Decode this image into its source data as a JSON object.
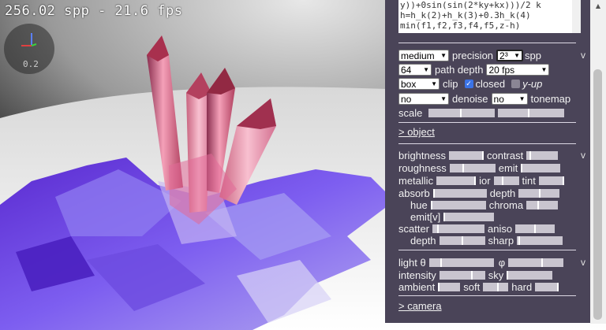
{
  "stats": {
    "fps_text": "256.02 spp - 21.6 fps"
  },
  "axis": {
    "value": "0.2"
  },
  "code": {
    "lines": [
      "y))+0sin(sin(2*ky+kx)))/2 k",
      "h=h_k(2)+h_k(3)+0.3h_k(4)",
      "min(f1,f2,f3,f4,f5,z-h)"
    ]
  },
  "render": {
    "precision_value": "medium",
    "precision_label": "precision",
    "spp_value": "2³",
    "spp_label": "spp",
    "v_label": "v",
    "path_depth_value": "64",
    "path_depth_label": "path depth",
    "fps_value": "20 fps",
    "clip_value": "box",
    "clip_label": "clip",
    "closed_label": "closed",
    "yup_label": "y-up",
    "denoise_value": "no",
    "denoise_label": "denoise",
    "tonemap_value": "no",
    "tonemap_label": "tonemap",
    "scale_label": "scale"
  },
  "object_link": "> object",
  "material": {
    "brightness": "brightness",
    "contrast": "contrast",
    "v_label": "v",
    "roughness": "roughness",
    "emit": "emit",
    "metallic": "metallic",
    "ior": "ior",
    "tint": "tint",
    "absorb": "absorb",
    "depth": "depth",
    "hue": "hue",
    "chroma": "chroma",
    "emit_v": "emit[v]",
    "scatter": "scatter",
    "aniso": "aniso",
    "depth2": "depth",
    "sharp": "sharp"
  },
  "light": {
    "light_theta": "light θ",
    "phi": "φ",
    "v_label": "v",
    "intensity": "intensity",
    "sky": "sky",
    "ambient": "ambient",
    "soft": "soft",
    "hard": "hard"
  },
  "camera_link": "> camera",
  "colors": {
    "panel_bg": "#4a4458",
    "accent_check": "#3b73e6"
  },
  "checkboxes": {
    "closed_checked": true,
    "yup_checked": false
  }
}
